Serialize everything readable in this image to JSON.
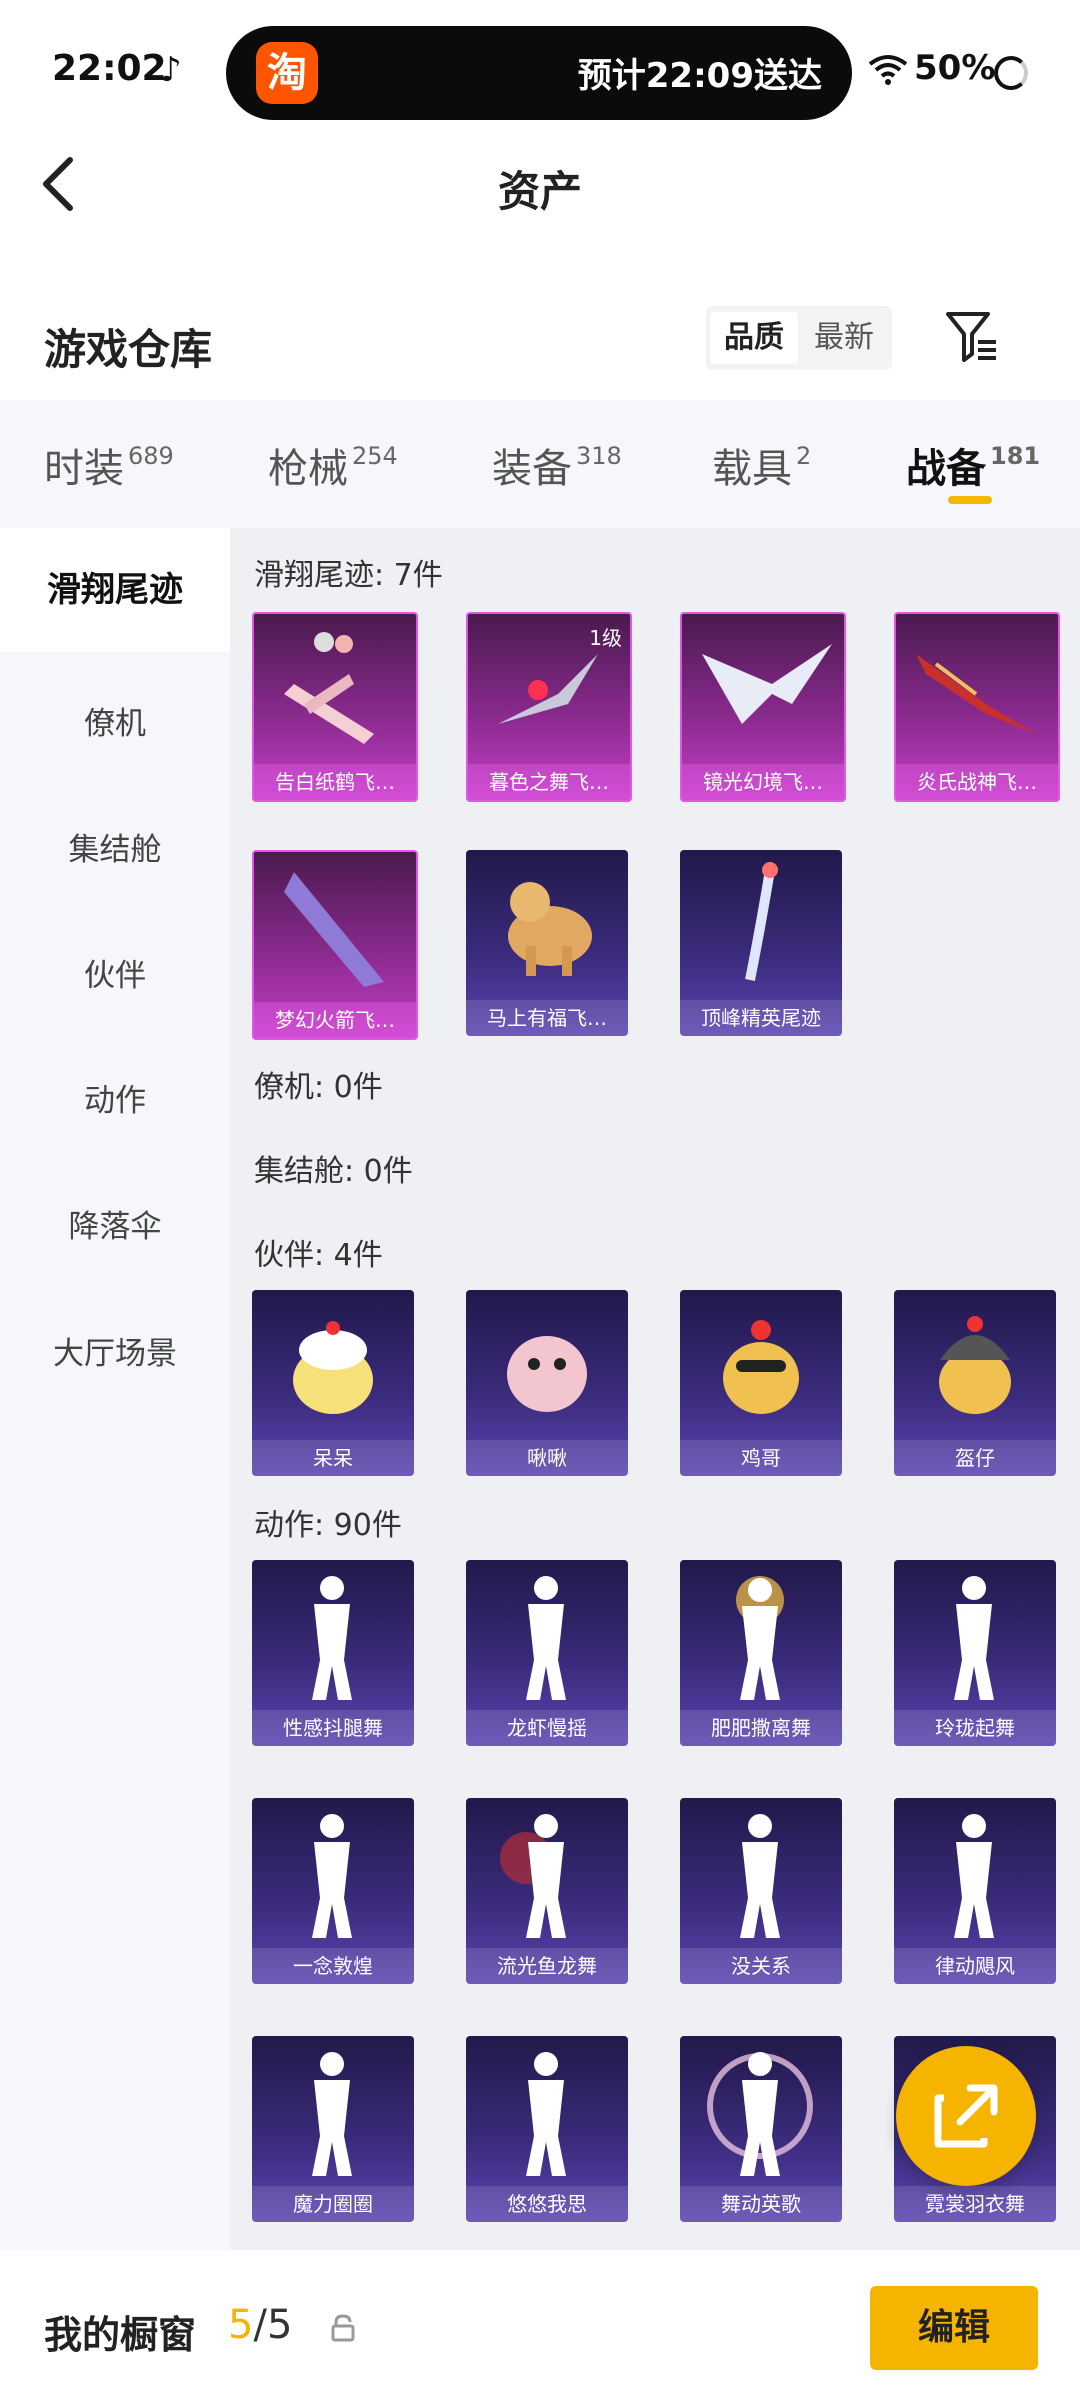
{
  "status_bar": {
    "time": "22:02",
    "tiktok_icon": "tiktok-icon",
    "taobao_badge": "淘",
    "delivery_text": "预计22:09送达",
    "battery": "50%"
  },
  "nav": {
    "title": "资产",
    "back_icon": "back-chevron-icon"
  },
  "header": {
    "title": "游戏仓库",
    "sort_options": [
      "品质",
      "最新"
    ],
    "active_sort": "品质",
    "filter_icon": "filter-icon"
  },
  "tabs": [
    {
      "label": "时装",
      "count": "689"
    },
    {
      "label": "枪械",
      "count": "254"
    },
    {
      "label": "装备",
      "count": "318"
    },
    {
      "label": "载具",
      "count": "2"
    },
    {
      "label": "战备",
      "count": "181",
      "active": true
    }
  ],
  "sidebar": [
    {
      "label": "滑翔尾迹",
      "active": true
    },
    {
      "label": "僚机"
    },
    {
      "label": "集结舱"
    },
    {
      "label": "伙伴"
    },
    {
      "label": "动作"
    },
    {
      "label": "降落伞"
    },
    {
      "label": "大厅场景"
    }
  ],
  "sections": {
    "glide": {
      "title": "滑翔尾迹: 7件",
      "items": [
        {
          "label": "告白纸鹤飞…",
          "rarity": "purple"
        },
        {
          "label": "暮色之舞飞…",
          "rarity": "purple",
          "level": "1级"
        },
        {
          "label": "镜光幻境飞…",
          "rarity": "purple"
        },
        {
          "label": "炎氏战神飞…",
          "rarity": "purple"
        },
        {
          "label": "梦幻火箭飞…",
          "rarity": "purple"
        },
        {
          "label": "马上有福飞…",
          "rarity": "blue"
        },
        {
          "label": "顶峰精英尾迹",
          "rarity": "blue"
        }
      ]
    },
    "wingman": {
      "title": "僚机: 0件"
    },
    "capsule": {
      "title": "集结舱: 0件"
    },
    "partner": {
      "title": "伙伴: 4件",
      "items": [
        {
          "label": "呆呆"
        },
        {
          "label": "啾啾"
        },
        {
          "label": "鸡哥"
        },
        {
          "label": "盔仔"
        }
      ]
    },
    "emote": {
      "title": "动作: 90件",
      "items": [
        {
          "label": "性感抖腿舞"
        },
        {
          "label": "龙虾慢摇"
        },
        {
          "label": "肥肥撒离舞"
        },
        {
          "label": "玲珑起舞"
        },
        {
          "label": "一念敦煌"
        },
        {
          "label": "流光鱼龙舞"
        },
        {
          "label": "没关系"
        },
        {
          "label": "律动飓风"
        },
        {
          "label": "魔力圈圈"
        },
        {
          "label": "悠悠我思"
        },
        {
          "label": "舞动英歌"
        },
        {
          "label": "霓裳羽衣舞"
        }
      ]
    }
  },
  "fab_icon": "share-icon",
  "bottom": {
    "showcase_label": "我的橱窗",
    "current": "5",
    "slash": "/",
    "total": "5",
    "lock_icon": "lock-icon",
    "edit_label": "编辑"
  },
  "colors": {
    "accent": "#f5b400",
    "purple_rarity": "#c43fc8",
    "blue_rarity": "#5b44b0"
  }
}
